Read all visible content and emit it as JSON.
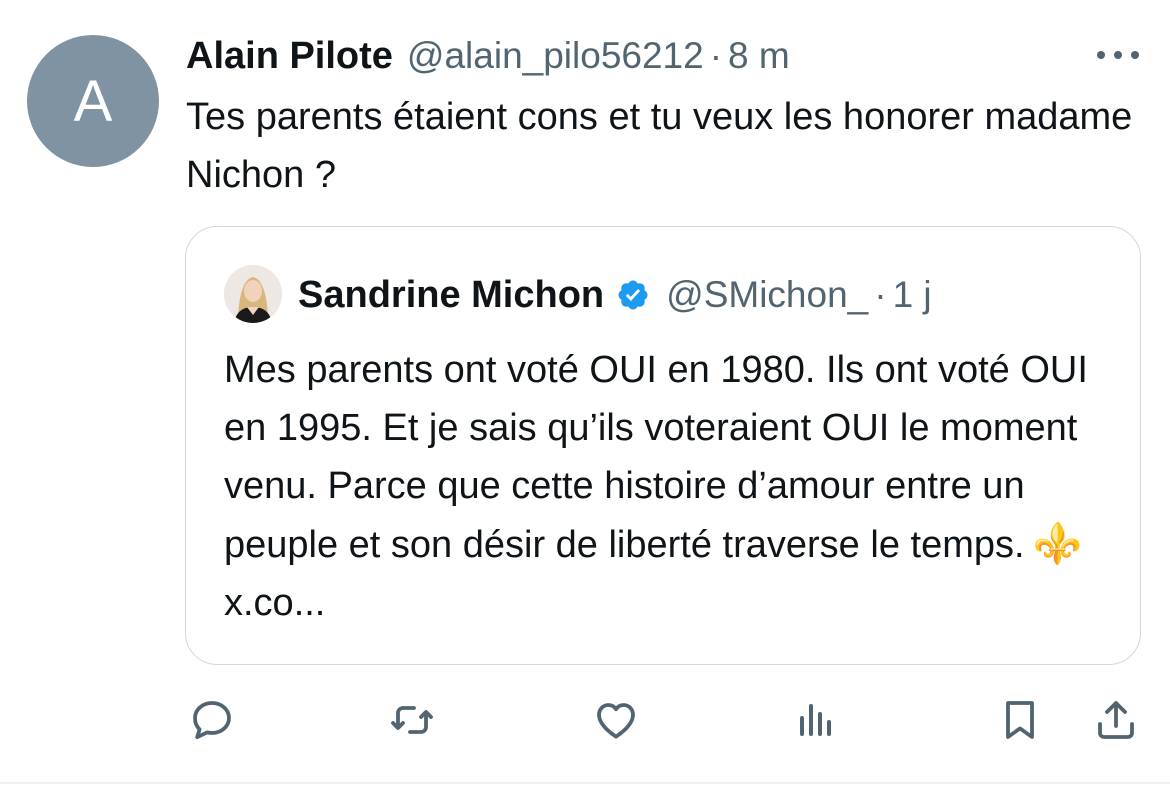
{
  "tweet": {
    "author": {
      "initial": "A",
      "name": "Alain Pilote",
      "handle": "@alain_pilo56212",
      "avatar_color": "#7f93a3"
    },
    "separator": "·",
    "time": "8 m",
    "text": "Tes parents étaient cons et tu veux les honorer madame Nichon ?",
    "more_icon": "more-horizontal-icon"
  },
  "quote": {
    "author": {
      "name": "Sandrine Michon",
      "handle": "@SMichon_",
      "verified": true,
      "verified_color": "#1d9bf0"
    },
    "separator": "·",
    "time": "1 j",
    "text": "Mes parents ont voté OUI en 1980. Ils ont voté OUI en 1995. Et je sais qu’ils voteraient OUI le moment venu. Parce que cette histoire d’amour entre un peuple et son désir de liberté traverse le temps.",
    "emoji": "⚜️",
    "link_text": "x.co..."
  },
  "actions": [
    {
      "name": "reply",
      "icon": "reply-icon"
    },
    {
      "name": "retweet",
      "icon": "retweet-icon"
    },
    {
      "name": "like",
      "icon": "heart-icon"
    },
    {
      "name": "views",
      "icon": "analytics-icon"
    },
    {
      "name": "bookmark",
      "icon": "bookmark-icon"
    },
    {
      "name": "share",
      "icon": "share-icon"
    }
  ],
  "colors": {
    "text": "#0f1419",
    "muted": "#536471",
    "border": "#cfd9de"
  }
}
